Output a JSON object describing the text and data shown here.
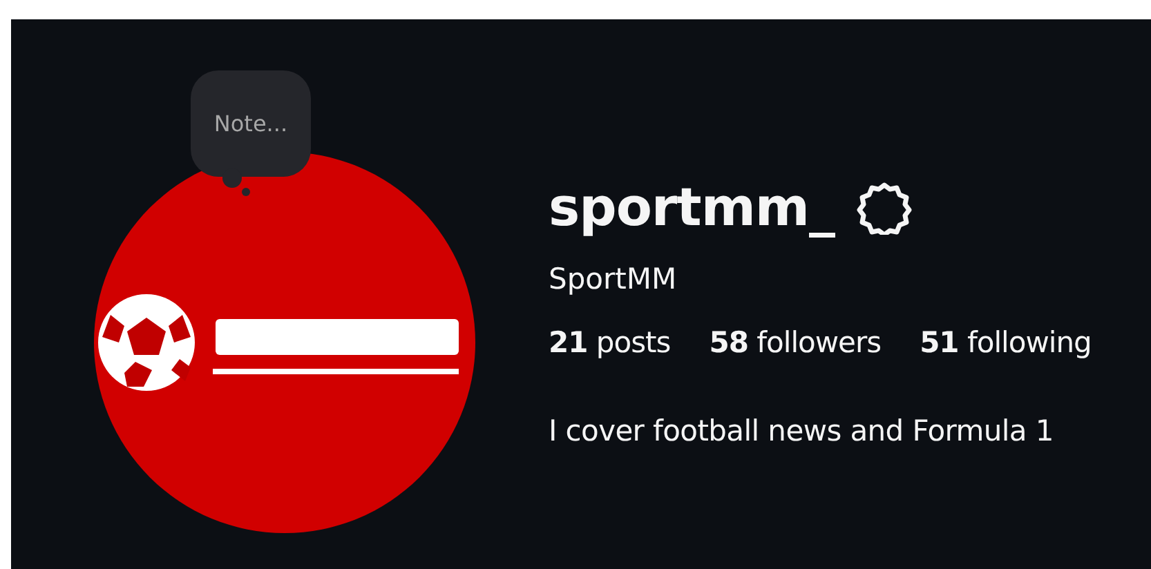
{
  "note": {
    "placeholder": "Note..."
  },
  "profile": {
    "username": "sportmm_",
    "display_name": "SportMM",
    "bio": "I cover football news and Formula 1"
  },
  "stats": [
    {
      "count": "21",
      "label": "posts"
    },
    {
      "count": "58",
      "label": "followers"
    },
    {
      "count": "51",
      "label": "following"
    }
  ]
}
